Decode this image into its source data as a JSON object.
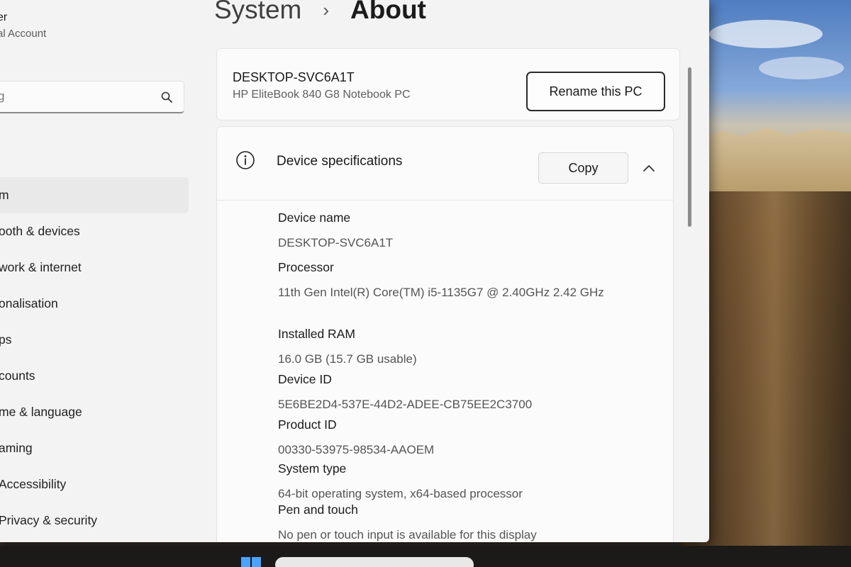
{
  "sidebar": {
    "user_name": "er",
    "user_type": "al Account",
    "search_placeholder": "g",
    "items": [
      {
        "label": "m",
        "selected": true
      },
      {
        "label": "ooth & devices"
      },
      {
        "label": "work & internet"
      },
      {
        "label": "onalisation"
      },
      {
        "label": "ps"
      },
      {
        "label": "counts"
      },
      {
        "label": "me & language"
      },
      {
        "label": "aming"
      },
      {
        "label": "Accessibility"
      },
      {
        "label": "Privacy & security"
      }
    ]
  },
  "breadcrumb": {
    "root": "System",
    "separator": "›",
    "current": "About"
  },
  "pc": {
    "name": "DESKTOP-SVC6A1T",
    "model": "HP EliteBook 840 G8 Notebook PC",
    "rename_label": "Rename this PC"
  },
  "device_specs": {
    "title": "Device specifications",
    "copy_label": "Copy",
    "rows": [
      {
        "label": "Device name",
        "value": "DESKTOP-SVC6A1T"
      },
      {
        "label": "Processor",
        "value": "11th Gen Intel(R) Core(TM) i5-1135G7 @ 2.40GHz   2.42 GHz"
      },
      {
        "label": "Installed RAM",
        "value": "16.0 GB (15.7 GB usable)"
      },
      {
        "label": "Device ID",
        "value": "5E6BE2D4-537E-44D2-ADEE-CB75EE2C3700"
      },
      {
        "label": "Product ID",
        "value": "00330-53975-98534-AAOEM"
      },
      {
        "label": "System type",
        "value": "64-bit operating system, x64-based processor"
      },
      {
        "label": "Pen and touch",
        "value": "No pen or touch input is available for this display"
      }
    ]
  },
  "icons": {
    "search": "search-icon",
    "info": "info-icon",
    "chevron": "chevron-up-icon",
    "start": "windows-start-icon"
  }
}
